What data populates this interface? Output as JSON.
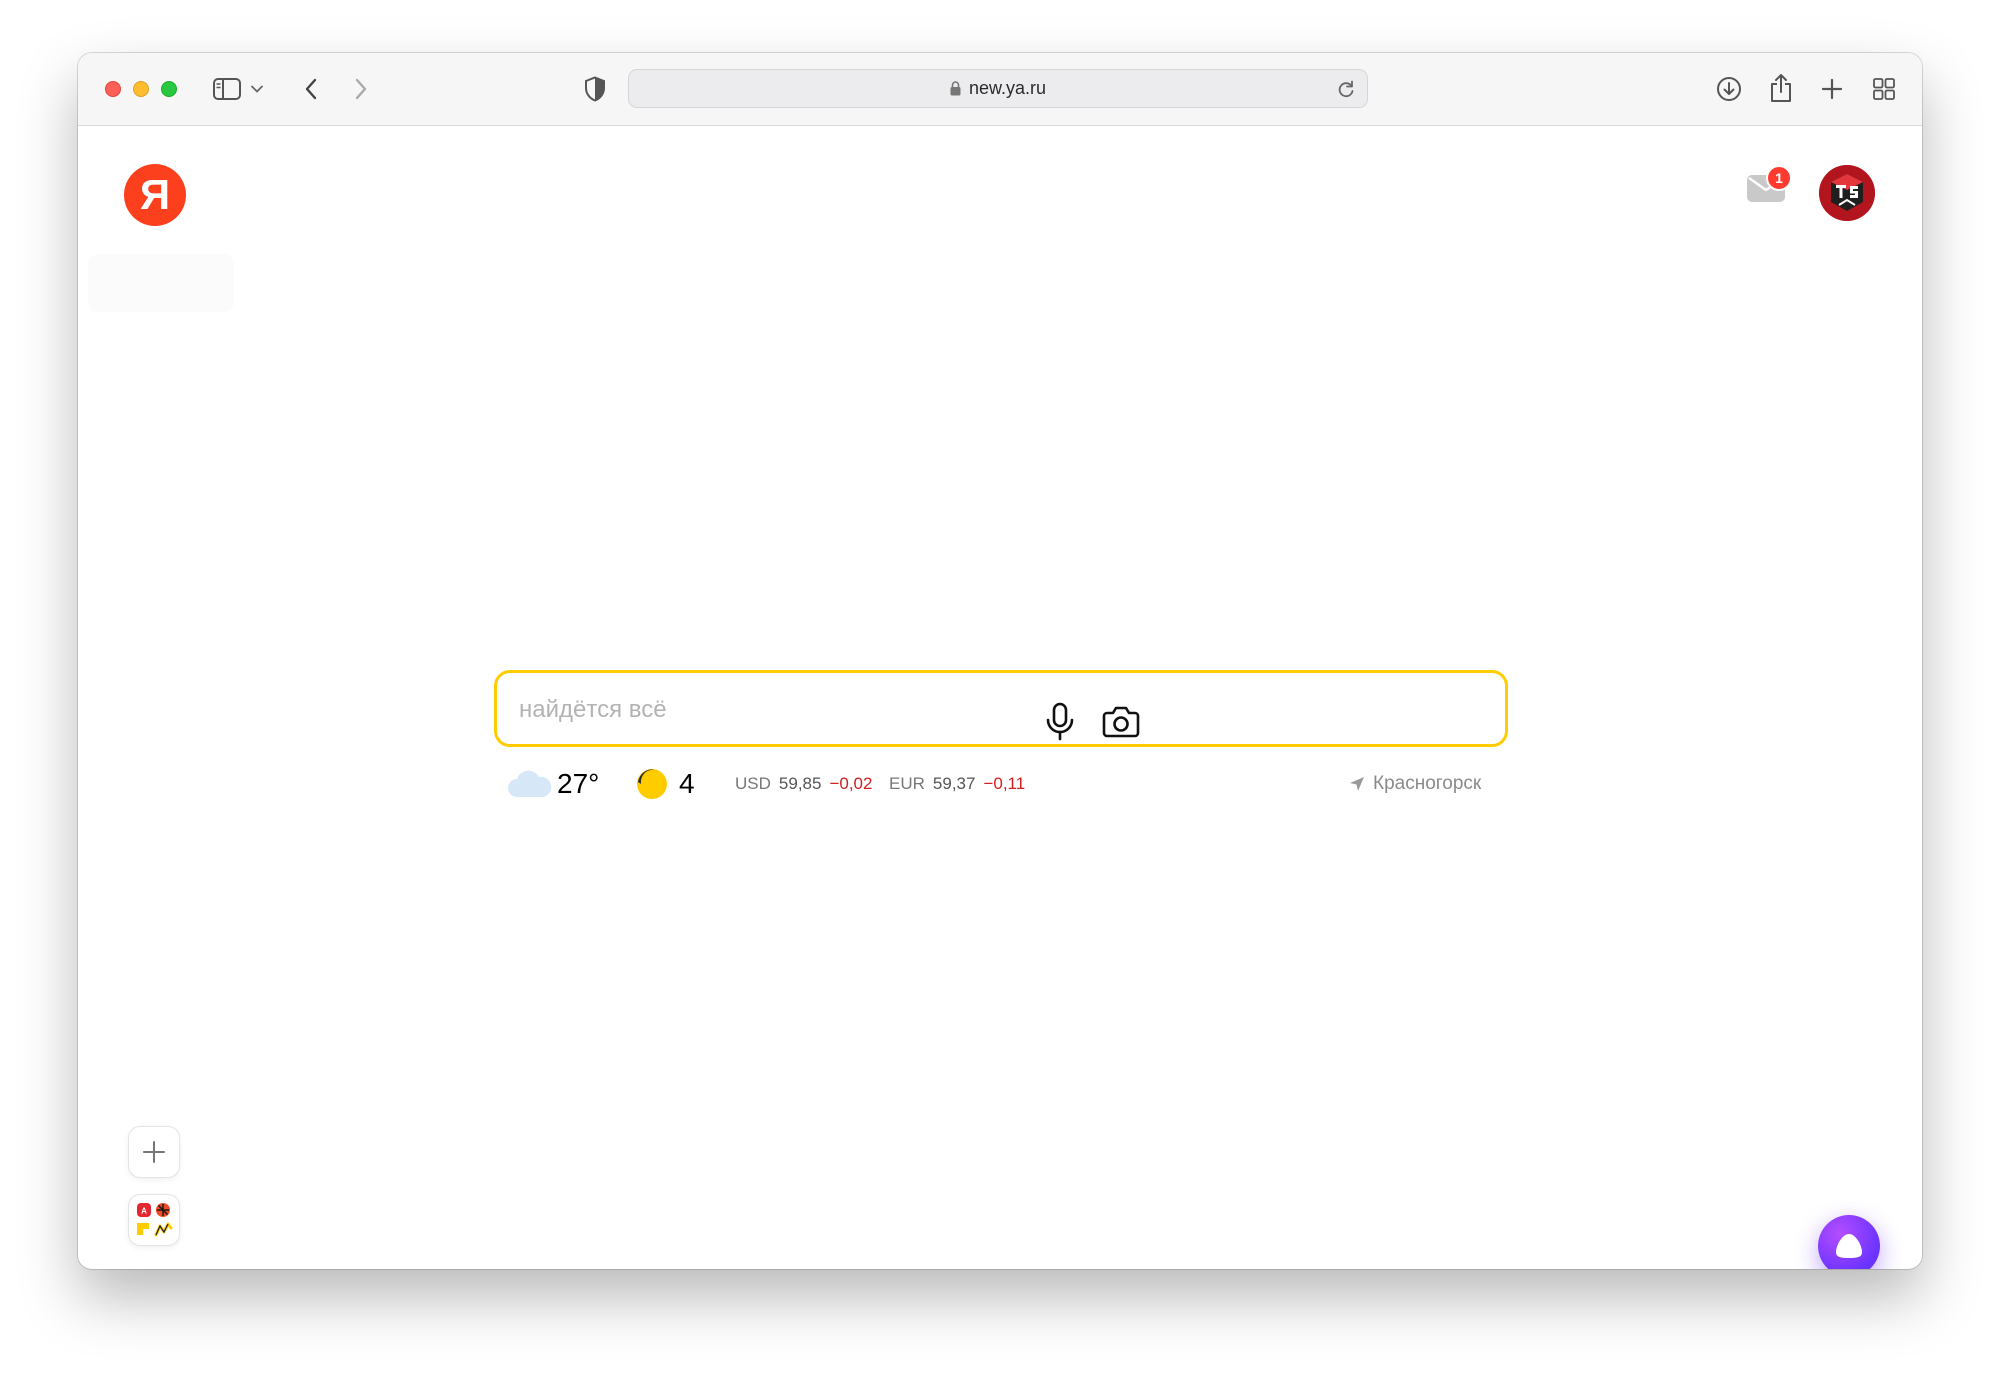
{
  "browser": {
    "url": "new.ya.ru",
    "icons": {
      "sidebar": "sidebar-icon",
      "sidebar_menu": "chevron-down-icon",
      "back": "back-arrow-icon",
      "forward": "forward-arrow-icon",
      "privacy": "shield-icon",
      "lock": "lock-icon",
      "reload": "reload-icon",
      "downloads": "download-icon",
      "share": "share-icon",
      "new_tab": "plus-icon",
      "tab_overview": "tab-grid-icon"
    }
  },
  "header": {
    "logo_letter": "Я",
    "mail_count": "1",
    "avatar": "avatar"
  },
  "search": {
    "placeholder": "найдётся всё",
    "value": ""
  },
  "info": {
    "temperature": "27°",
    "weather_icon": "cloud-icon",
    "traffic_score": "4",
    "traffic_icon": "traffic-icon",
    "usd_label": "USD",
    "usd_value": "59,85",
    "usd_change": "−0,02",
    "eur_label": "EUR",
    "eur_value": "59,37",
    "eur_change": "−0,11",
    "location": "Красногорск",
    "location_icon": "location-arrow-icon"
  },
  "bottom": {
    "add_icon": "plus-icon",
    "services_icon": "services-grid-icon",
    "alice_icon": "alice-icon"
  },
  "colors": {
    "accent_red": "#fc3f1d",
    "search_border": "#ffcc00",
    "negative_change": "#d21f1f",
    "alice_purple": "#7a3cff"
  }
}
